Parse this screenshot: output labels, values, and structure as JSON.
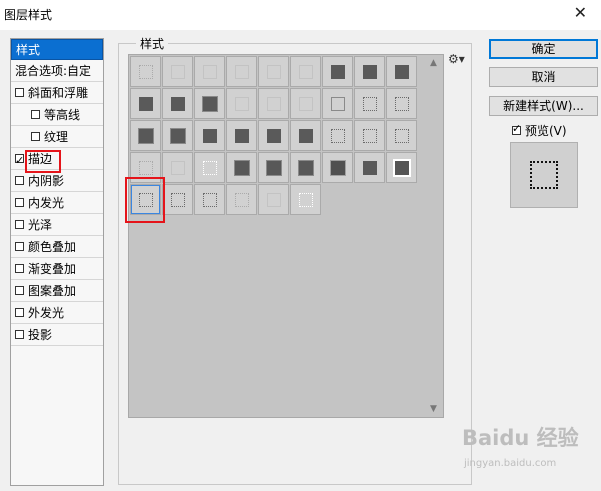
{
  "window": {
    "title": "图层样式",
    "close_glyph": "✕"
  },
  "left_panel": {
    "items": [
      {
        "label": "样式",
        "checkbox": false,
        "checked": false,
        "selected": true
      },
      {
        "label": "混合选项:自定",
        "checkbox": false,
        "checked": false,
        "selected": false
      },
      {
        "label": "斜面和浮雕",
        "checkbox": true,
        "checked": false,
        "selected": false
      },
      {
        "label": "等高线",
        "checkbox": true,
        "checked": false,
        "selected": false,
        "sub": true
      },
      {
        "label": "纹理",
        "checkbox": true,
        "checked": false,
        "selected": false,
        "sub": true
      },
      {
        "label": "描边",
        "checkbox": true,
        "checked": true,
        "selected": false
      },
      {
        "label": "内阴影",
        "checkbox": true,
        "checked": false,
        "selected": false
      },
      {
        "label": "内发光",
        "checkbox": true,
        "checked": false,
        "selected": false
      },
      {
        "label": "光泽",
        "checkbox": true,
        "checked": false,
        "selected": false
      },
      {
        "label": "颜色叠加",
        "checkbox": true,
        "checked": false,
        "selected": false
      },
      {
        "label": "渐变叠加",
        "checkbox": true,
        "checked": false,
        "selected": false
      },
      {
        "label": "图案叠加",
        "checkbox": true,
        "checked": false,
        "selected": false
      },
      {
        "label": "外发光",
        "checkbox": true,
        "checked": false,
        "selected": false
      },
      {
        "label": "投影",
        "checkbox": true,
        "checked": false,
        "selected": false
      }
    ]
  },
  "styles_group": {
    "label": "样式",
    "gear_icon": "gear-icon",
    "swatch_rows": [
      [
        "dotted-light",
        "faint",
        "faint",
        "faint",
        "faint",
        "faint",
        "solid",
        "solid",
        "solid"
      ],
      [
        "solid",
        "solid",
        "fuzzy",
        "faint",
        "faint",
        "faint",
        "gray-outline",
        "dotted",
        "dotted"
      ],
      [
        "fuzzy",
        "fuzzy",
        "solid",
        "solid",
        "solid",
        "solid",
        "dotted",
        "dotted",
        "dotted"
      ],
      [
        "dotted-light",
        "faint",
        "white-dotted",
        "fuzzy",
        "fuzzy",
        "fuzzy",
        "ring-gray",
        "solid",
        "ring-white"
      ],
      [
        "dotted",
        "dotted",
        "dotted",
        "dotted-light",
        "faint",
        "white-dotted"
      ]
    ],
    "selected_swatch": {
      "row": 4,
      "col": 0
    }
  },
  "buttons": {
    "ok": "确定",
    "cancel": "取消",
    "new_style": "新建样式(W)...",
    "preview_label": "预览(V)",
    "preview_checked": true
  },
  "watermark": {
    "line1": "Baidu 经验",
    "line2": "jingyan.baidu.com"
  },
  "colors": {
    "selection_blue": "#0b6fd1",
    "highlight_red": "#e5141a"
  }
}
